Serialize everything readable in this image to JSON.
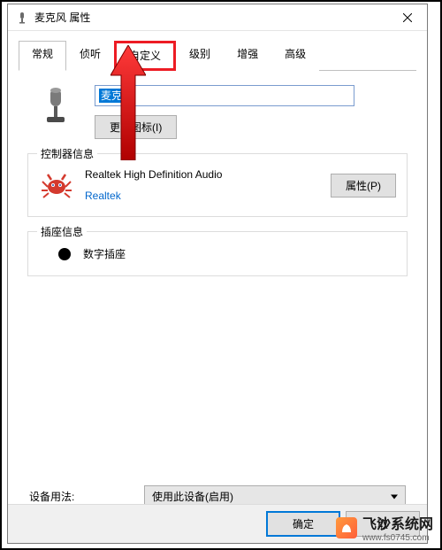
{
  "window": {
    "title": "麦克风 属性"
  },
  "tabs": {
    "general": "常规",
    "listen": "侦听",
    "custom": "自定义",
    "levels": "级别",
    "enhance": "增强",
    "advanced": "高级"
  },
  "device": {
    "name": "麦克风",
    "change_icon": "更改图标(I)"
  },
  "controller": {
    "group_title": "控制器信息",
    "name": "Realtek High Definition Audio",
    "vendor": "Realtek",
    "properties_btn": "属性(P)"
  },
  "jack": {
    "group_title": "插座信息",
    "name": "数字插座"
  },
  "usage": {
    "label": "设备用法:",
    "value": "使用此设备(启用)"
  },
  "footer": {
    "ok": "确定",
    "cancel": "取"
  },
  "watermark": {
    "name": "飞沙系统网",
    "url": "www.fs0745.com"
  }
}
